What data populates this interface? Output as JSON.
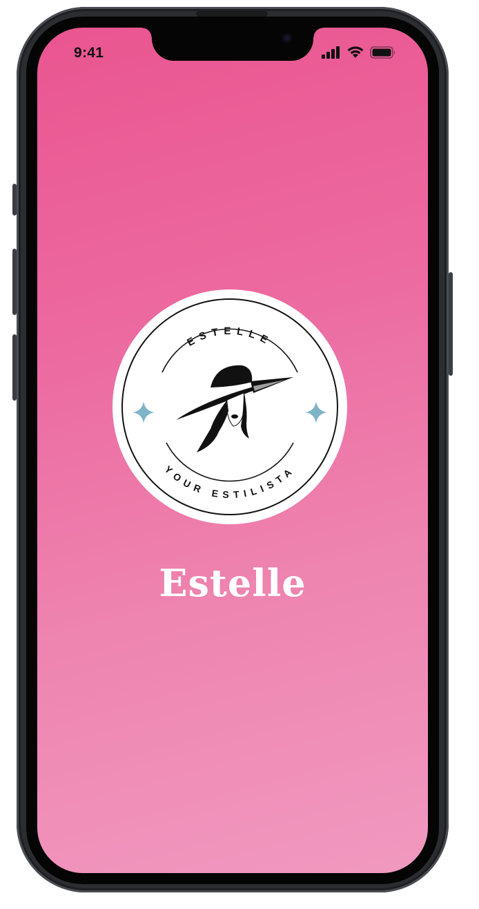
{
  "status_bar": {
    "time": "9:41",
    "icons": [
      "cellular-signal-icon",
      "wifi-icon",
      "battery-icon"
    ]
  },
  "logo": {
    "top_text": "ESTELLE",
    "bottom_text": "YOUR ESTILISTA",
    "emblem": "woman-in-hat-icon",
    "sparkle_color": "#7fb3c8"
  },
  "app": {
    "name": "Estelle"
  },
  "colors": {
    "gradient_top": "#ea5590",
    "gradient_bottom": "#f199c0",
    "title": "#ffffff"
  }
}
